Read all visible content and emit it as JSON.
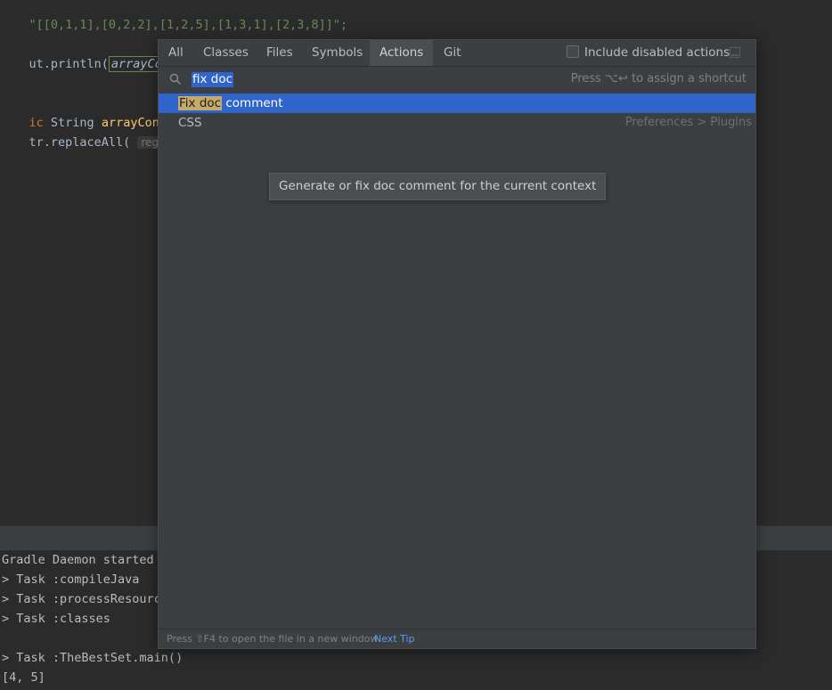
{
  "editor": {
    "line1": "\"[[0,1,1],[0,2,2],[1,2,5],[1,3,1],[2,3,8]]\";",
    "line2_prefix": "ut.println(",
    "line2_fn": "arrayConvert",
    "line3_kw": "ic ",
    "line3_type": "String ",
    "line3_fn": "arrayConverte",
    "line4_prefix": "tr.replaceAll( ",
    "line4_hint": "regex:",
    "line4_str": " \"\\\\"
  },
  "console": {
    "lines": [
      "Gradle Daemon started i",
      "> Task :compileJava",
      "> Task :processResource",
      "> Task :classes",
      "",
      "> Task :TheBestSet.main()",
      "[4, 5]"
    ]
  },
  "popup": {
    "tabs": [
      "All",
      "Classes",
      "Files",
      "Symbols",
      "Actions",
      "Git"
    ],
    "active_tab": "Actions",
    "include_disabled_label": "Include disabled actions",
    "include_disabled_checked": false,
    "search_value": "fix doc",
    "shortcut_hint": "Press ⌥↩ to assign a shortcut",
    "results": [
      {
        "match": "Fix doc",
        "rest": " comment",
        "right": "",
        "selected": true
      },
      {
        "match": "",
        "rest": "CSS",
        "right": "Preferences > Plugins",
        "selected": false
      }
    ],
    "tooltip": "Generate or fix doc comment for the current context",
    "footer_text": "Press ⇧F4 to open the file in a new window",
    "footer_link": "Next Tip"
  },
  "colors": {
    "accent": "#2f65ca",
    "match_highlight": "#c4a96b",
    "link": "#589df6"
  }
}
